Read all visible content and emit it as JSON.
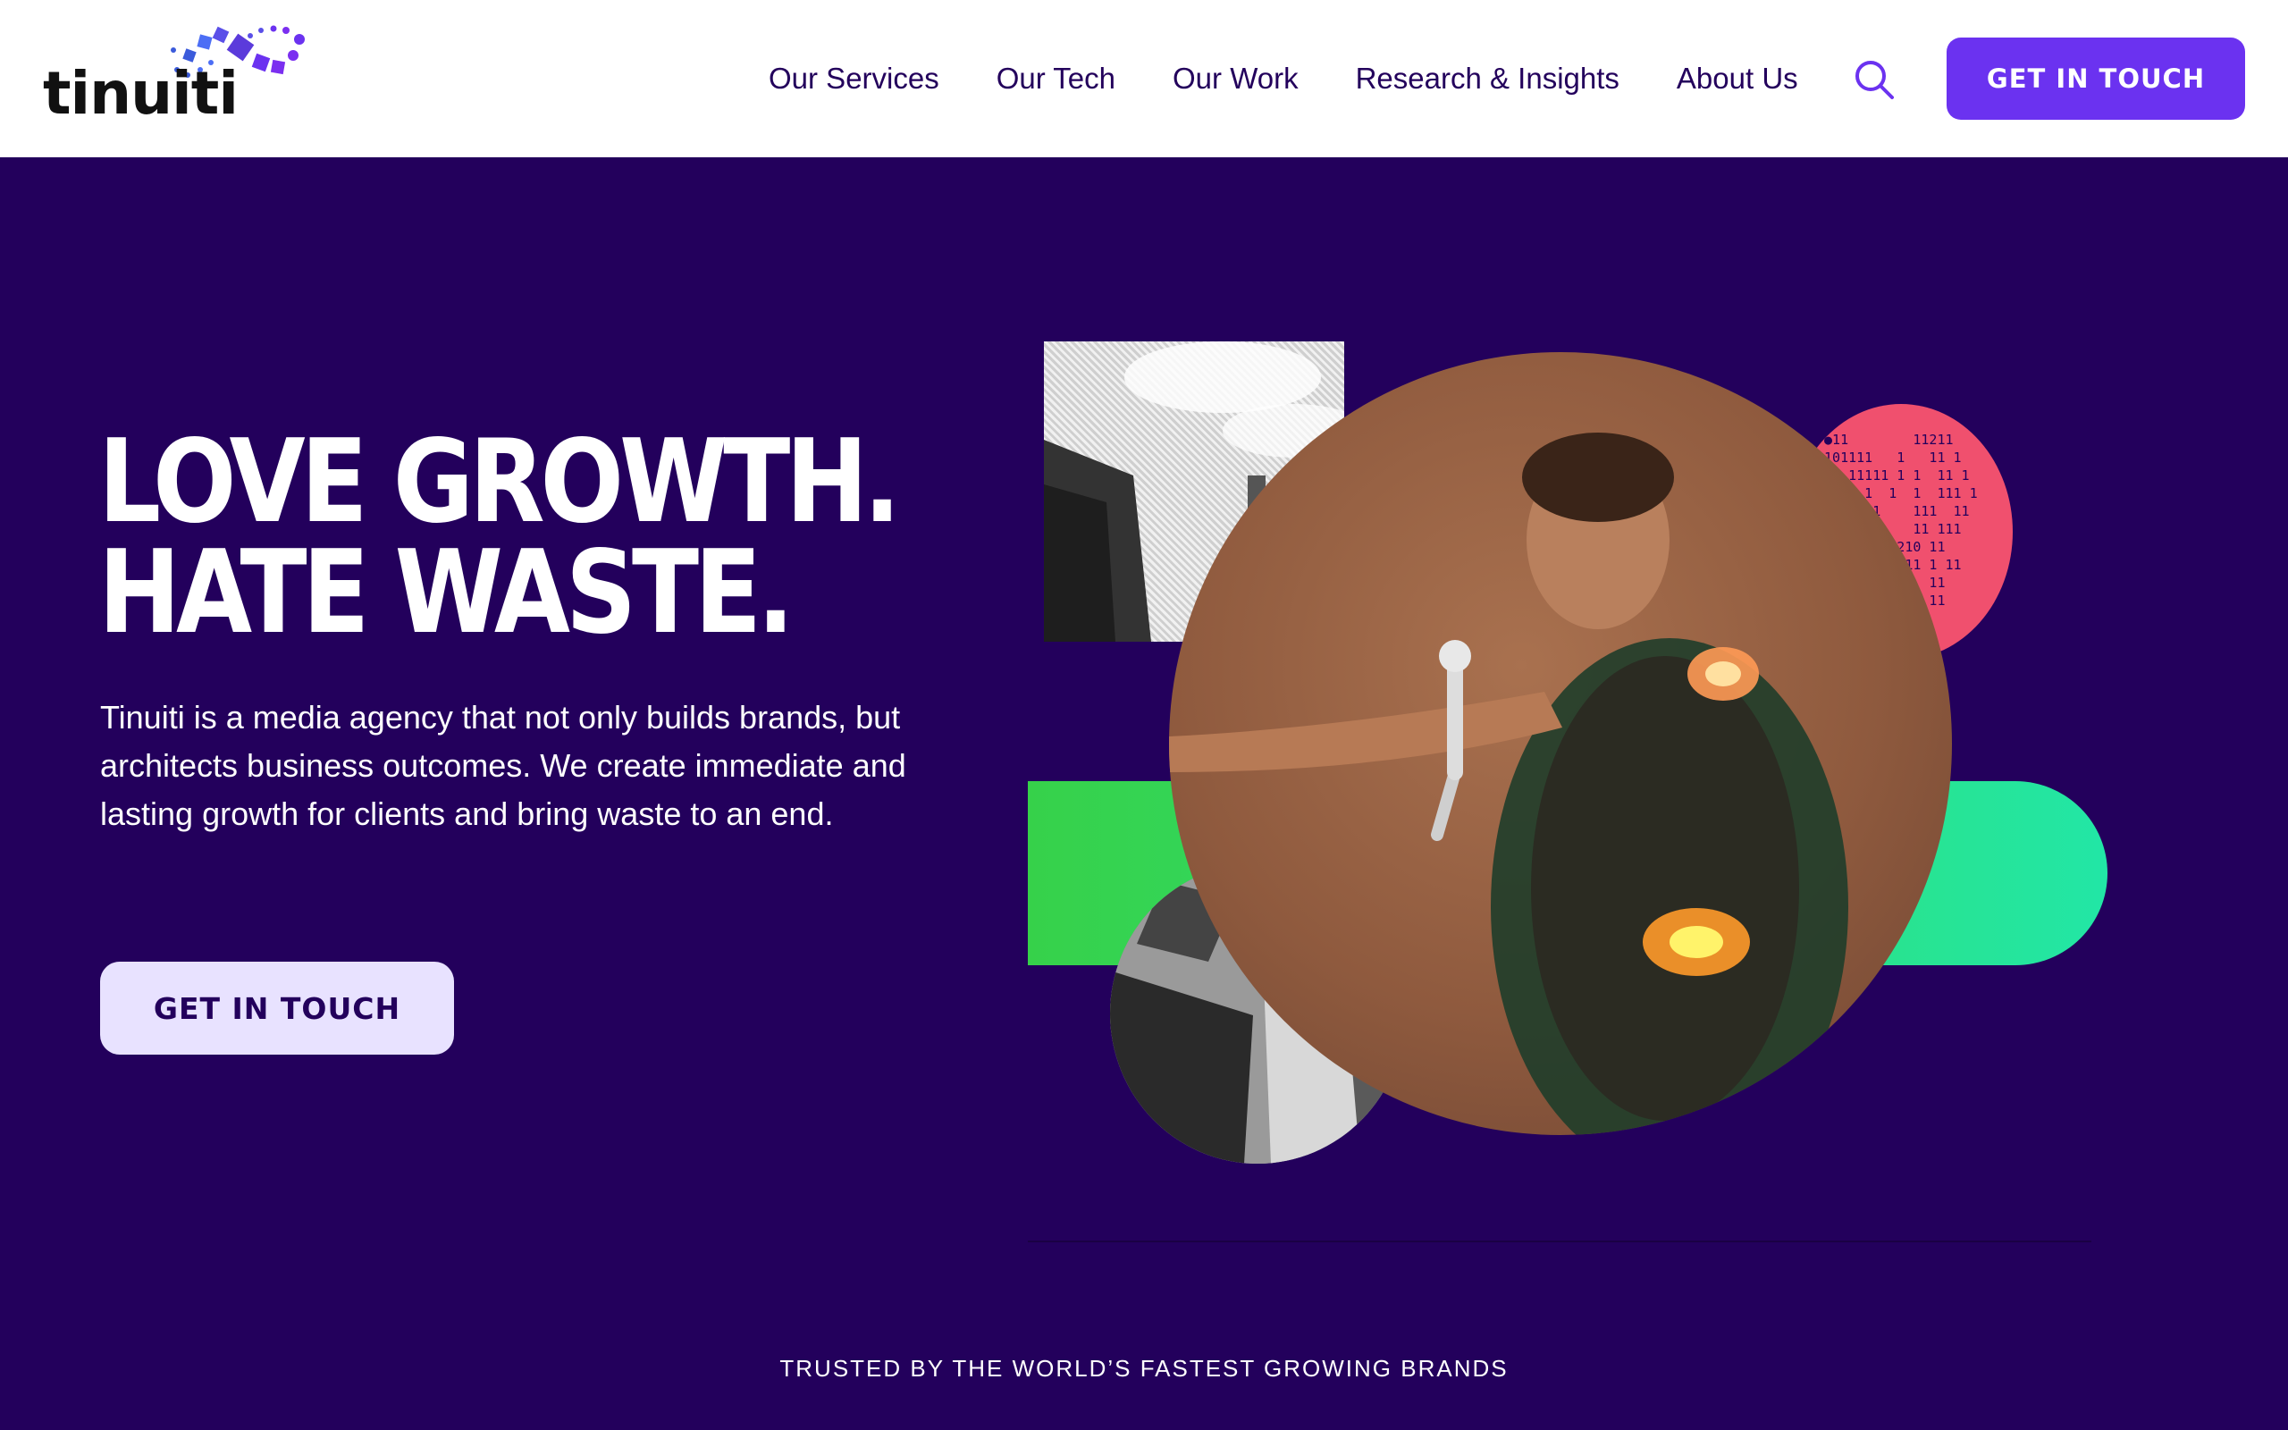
{
  "brand": {
    "logo_text": "tinuiti",
    "accent": "#6b32f0",
    "navy": "#23005c"
  },
  "nav": {
    "items": [
      {
        "label": "Our Services"
      },
      {
        "label": "Our Tech"
      },
      {
        "label": "Our Work"
      },
      {
        "label": "Research & Insights"
      },
      {
        "label": "About Us"
      }
    ],
    "search_icon": "search-icon",
    "cta_label": "GET IN TOUCH"
  },
  "hero": {
    "headline_line1": "LOVE GROWTH.",
    "headline_line2": "HATE WASTE.",
    "body": "Tinuiti is a media agency that not only builds brands, but architects business outcomes. We create immediate and lasting growth for clients and bring waste to an end.",
    "cta_label": "GET IN TOUCH"
  },
  "trusted": {
    "label": "TRUSTED BY THE WORLD’S FASTEST GROWING BRANDS"
  }
}
